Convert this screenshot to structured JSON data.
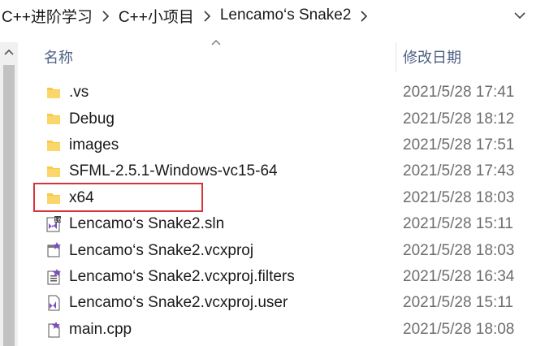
{
  "breadcrumb": {
    "items": [
      "C++进阶学习",
      "C++小项目",
      "Lencamo‘s Snake2"
    ]
  },
  "columns": {
    "name": "名称",
    "date_modified": "修改日期"
  },
  "files": [
    {
      "name": ".vs",
      "date": "2021/5/28 17:41",
      "icon": "folder-icon"
    },
    {
      "name": "Debug",
      "date": "2021/5/28 18:12",
      "icon": "folder-icon"
    },
    {
      "name": "images",
      "date": "2021/5/28 17:51",
      "icon": "folder-icon"
    },
    {
      "name": "SFML-2.5.1-Windows-vc15-64",
      "date": "2021/5/28 17:43",
      "icon": "folder-icon"
    },
    {
      "name": "x64",
      "date": "2021/5/28 18:03",
      "icon": "folder-icon"
    },
    {
      "name": "Lencamo‘s Snake2.sln",
      "date": "2021/5/28 15:11",
      "icon": "sln-file-icon"
    },
    {
      "name": "Lencamo‘s Snake2.vcxproj",
      "date": "2021/5/28 18:03",
      "icon": "vcxproj-file-icon"
    },
    {
      "name": "Lencamo‘s Snake2.vcxproj.filters",
      "date": "2021/5/28 16:34",
      "icon": "filters-file-icon"
    },
    {
      "name": "Lencamo‘s Snake2.vcxproj.user",
      "date": "2021/5/28 15:11",
      "icon": "user-file-icon"
    },
    {
      "name": "main.cpp",
      "date": "2021/5/28 18:08",
      "icon": "cpp-file-icon"
    }
  ],
  "colors": {
    "folder": "#f8c94a",
    "highlight": "#d6333c",
    "header_text": "#4d6082",
    "date_text": "#6d6d6d"
  }
}
